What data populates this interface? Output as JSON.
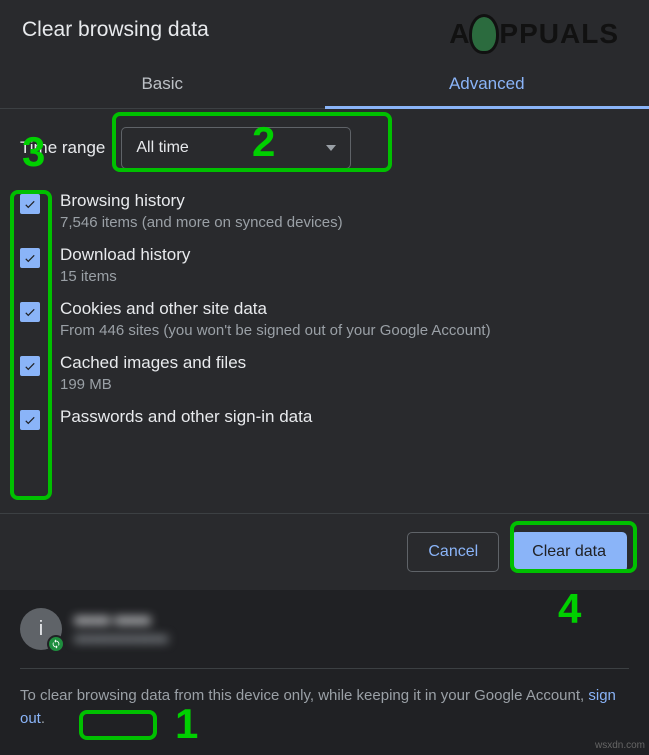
{
  "dialog": {
    "title": "Clear browsing data",
    "tabs": {
      "basic": "Basic",
      "advanced": "Advanced"
    },
    "timeRange": {
      "label": "Time range",
      "value": "All time"
    },
    "items": [
      {
        "title": "Browsing history",
        "sub": "7,546 items (and more on synced devices)"
      },
      {
        "title": "Download history",
        "sub": "15 items"
      },
      {
        "title": "Cookies and other site data",
        "sub": "From 446 sites (you won't be signed out of your Google Account)"
      },
      {
        "title": "Cached images and files",
        "sub": "199 MB"
      },
      {
        "title": "Passwords and other sign-in data",
        "sub": ""
      }
    ],
    "buttons": {
      "cancel": "Cancel",
      "clear": "Clear data"
    }
  },
  "account": {
    "avatarLetter": "i",
    "name": "■■■■ ■■■■",
    "email": "■■■■■■■■■■■■"
  },
  "signout": {
    "pre": "To clear browsing data from this device only, while keeping it in your Google Account, ",
    "link": "sign out",
    "post": "."
  },
  "annotations": {
    "n1": "1",
    "n2": "2",
    "n3": "3",
    "n4": "4"
  },
  "branding": {
    "logoText": "PPUALS"
  },
  "watermark": "wsxdn.com"
}
